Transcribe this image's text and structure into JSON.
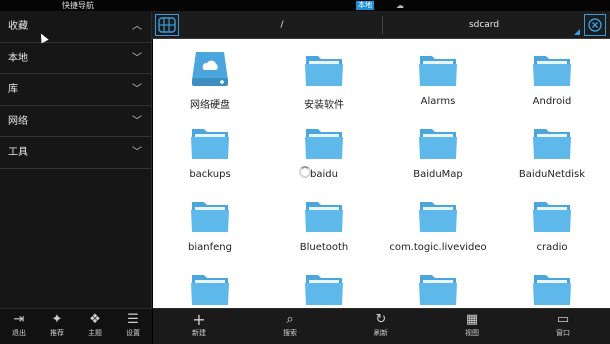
{
  "status_bar": {
    "app_title": "快捷导航",
    "local_tag": "本地",
    "cloud_glyph": "☁"
  },
  "sidebar": {
    "items": [
      {
        "label": "收藏",
        "chevron": "︿"
      },
      {
        "label": "本地",
        "chevron": "﹀"
      },
      {
        "label": "库",
        "chevron": "﹀"
      },
      {
        "label": "网络",
        "chevron": "﹀"
      },
      {
        "label": "工具",
        "chevron": "﹀"
      }
    ]
  },
  "path_bar": {
    "root": "/",
    "current": "sdcard"
  },
  "files": [
    {
      "name": "网络硬盘",
      "icon": "cloud-drive-icon"
    },
    {
      "name": "安装软件",
      "icon": "folder-icon"
    },
    {
      "name": "Alarms",
      "icon": "folder-icon"
    },
    {
      "name": "Android",
      "icon": "folder-icon"
    },
    {
      "name": "backups",
      "icon": "folder-icon"
    },
    {
      "name": "baidu",
      "icon": "folder-icon"
    },
    {
      "name": "BaiduMap",
      "icon": "folder-icon"
    },
    {
      "name": "BaiduNetdisk",
      "icon": "folder-icon"
    },
    {
      "name": "bianfeng",
      "icon": "folder-icon"
    },
    {
      "name": "Bluetooth",
      "icon": "folder-icon"
    },
    {
      "name": "com.togic.livevideo",
      "icon": "folder-icon"
    },
    {
      "name": "cradio",
      "icon": "folder-icon"
    },
    {
      "name": "",
      "icon": "folder-icon"
    },
    {
      "name": "",
      "icon": "folder-icon"
    },
    {
      "name": "",
      "icon": "folder-icon"
    },
    {
      "name": "",
      "icon": "folder-icon"
    }
  ],
  "bottom_left": [
    {
      "label": "退出",
      "icon": "exit-icon",
      "glyph": "⇥"
    },
    {
      "label": "推荐",
      "icon": "gift-icon",
      "glyph": "✦"
    },
    {
      "label": "主题",
      "icon": "palette-icon",
      "glyph": "❖"
    },
    {
      "label": "设置",
      "icon": "settings-icon",
      "glyph": "☰"
    }
  ],
  "bottom_right": [
    {
      "label": "新建",
      "icon": "plus-icon",
      "glyph": "+"
    },
    {
      "label": "搜索",
      "icon": "search-icon",
      "glyph": "⌕"
    },
    {
      "label": "刷新",
      "icon": "refresh-icon",
      "glyph": "↻"
    },
    {
      "label": "视图",
      "icon": "grid-view-icon",
      "glyph": "▦"
    },
    {
      "label": "窗口",
      "icon": "window-icon",
      "glyph": "▭"
    }
  ],
  "colors": {
    "accent": "#3a9bdc",
    "folder": "#5fb8ea",
    "folder_tab": "#4aa6dc",
    "sidebar_bg": "#161616",
    "content_bg": "#ffffff"
  }
}
